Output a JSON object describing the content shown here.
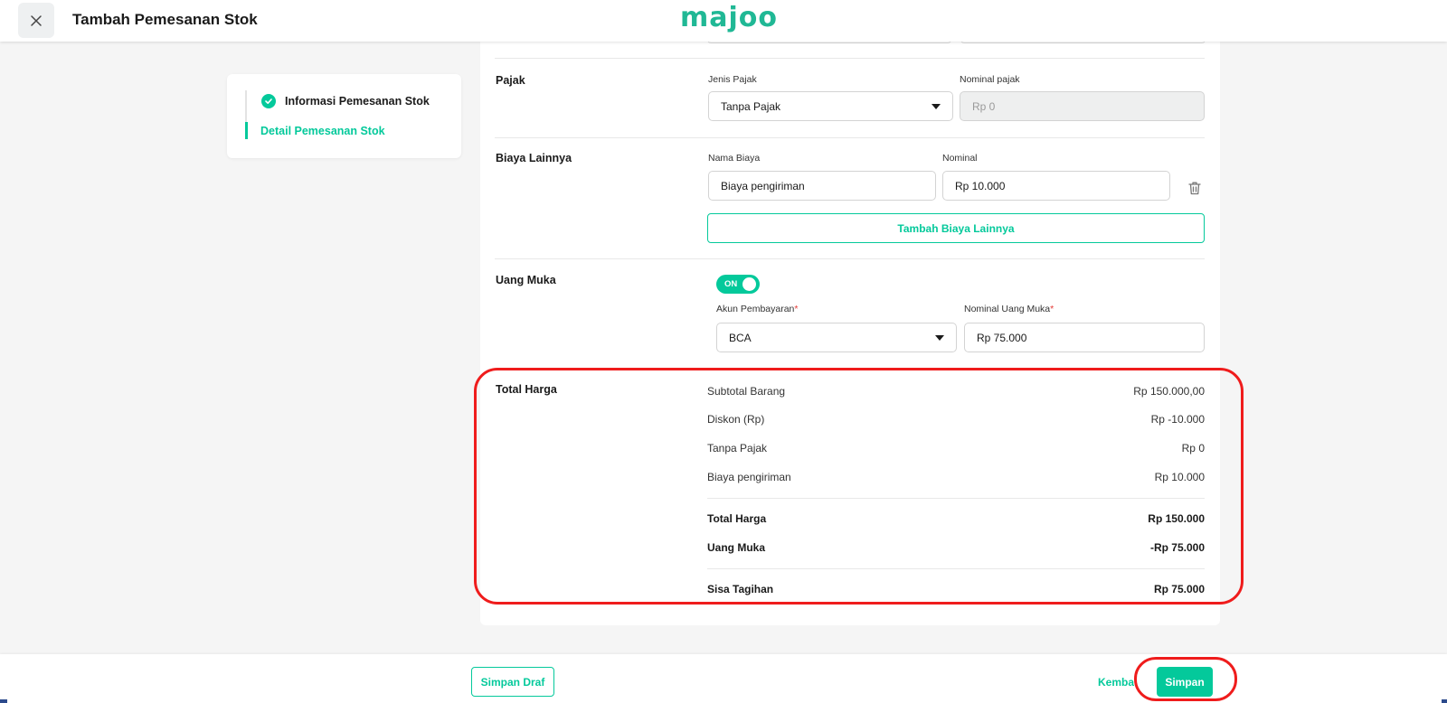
{
  "header": {
    "title": "Tambah Pemesanan Stok",
    "logo_text": "majoo",
    "brand_color": "#20b895"
  },
  "stepper": {
    "steps": [
      {
        "label": "Informasi Pemesanan Stok",
        "status": "completed"
      },
      {
        "label": "Detail Pemesanan Stok",
        "status": "active"
      }
    ]
  },
  "tax": {
    "section_label": "Pajak",
    "type_label": "Jenis Pajak",
    "type_value": "Tanpa Pajak",
    "nominal_label": "Nominal pajak",
    "nominal_placeholder": "Rp 0"
  },
  "other_costs": {
    "section_label": "Biaya Lainnya",
    "name_label": "Nama Biaya",
    "name_value": "Biaya pengiriman",
    "nominal_label": "Nominal",
    "nominal_value": "Rp 10.000",
    "add_button": "Tambah Biaya Lainnya"
  },
  "down_payment": {
    "section_label": "Uang Muka",
    "toggle_text": "ON",
    "account_label": "Akun Pembayaran",
    "account_value": "BCA",
    "amount_label": "Nominal Uang Muka",
    "amount_value": "Rp 75.000",
    "required_mark": "*"
  },
  "total": {
    "section_label": "Total Harga",
    "rows": [
      {
        "label": "Subtotal Barang",
        "value": "Rp 150.000,00"
      },
      {
        "label": "Diskon (Rp)",
        "value": "Rp -10.000"
      },
      {
        "label": "Tanpa Pajak",
        "value": "Rp 0"
      },
      {
        "label": "Biaya pengiriman",
        "value": "Rp 10.000"
      }
    ],
    "total_label": "Total Harga",
    "total_value": "Rp 150.000",
    "dp_label": "Uang Muka",
    "dp_value": "-Rp 75.000",
    "remaining_label": "Sisa Tagihan",
    "remaining_value": "Rp 75.000"
  },
  "footer": {
    "draft_button": "Simpan Draf",
    "back_button": "Kembali",
    "save_button": "Simpan"
  },
  "colors": {
    "accent": "#04c99b",
    "highlight": "#ef1c1c"
  }
}
